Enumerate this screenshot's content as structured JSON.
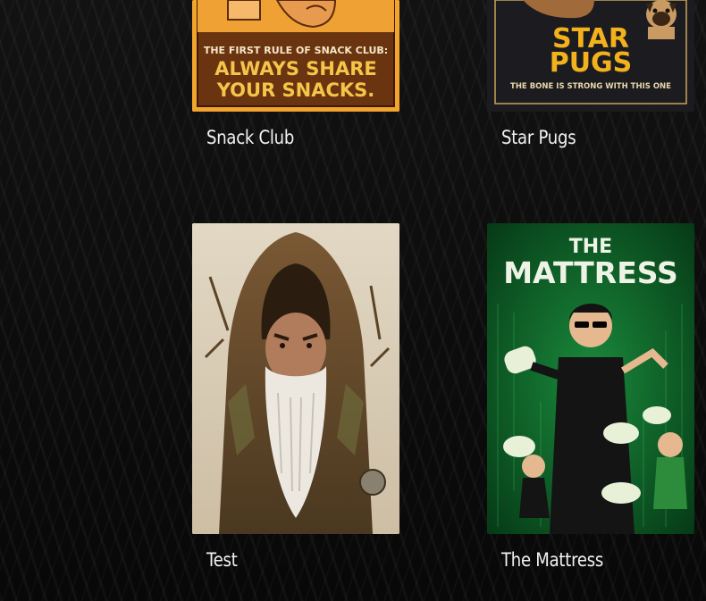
{
  "movies": [
    {
      "title": "Snack Club",
      "poster": {
        "tagline": "THE FIRST RULE OF SNACK CLUB:",
        "headline_line1": "ALWAYS SHARE",
        "headline_line2": "YOUR SNACKS."
      }
    },
    {
      "title": "Star Pugs",
      "poster": {
        "headline_line1": "STAR",
        "headline_line2": "PUGS",
        "tagline": "THE BONE IS STRONG WITH THIS ONE"
      }
    },
    {
      "title": "Test",
      "poster": {}
    },
    {
      "title": "The Mattress",
      "poster": {
        "headline_line1": "THE",
        "headline_line2": "MATTRESS"
      }
    }
  ],
  "colors": {
    "background": "#0c0c0c",
    "title_text": "#f2f2f2",
    "snack_poster": "#f2a12a",
    "star_pugs_gold": "#f3b21c",
    "mattress_green": "#0c5a26"
  }
}
